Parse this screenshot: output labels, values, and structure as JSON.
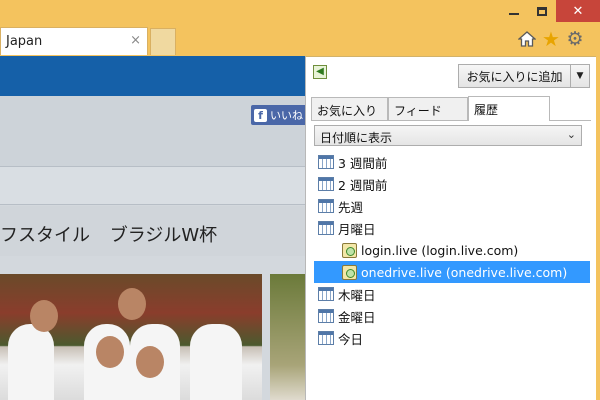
{
  "window": {
    "min_glyph": "",
    "close_glyph": "✕"
  },
  "tab": {
    "title": "Japan",
    "close_glyph": "×"
  },
  "toolbar_icons": [
    "home-icon",
    "star-icon",
    "gear-icon"
  ],
  "webpage": {
    "like_label": "いいね",
    "nav_text": "フスタイル ブラジルW杯"
  },
  "pane": {
    "add_favorites_label": "お気に入りに追加",
    "add_dropdown_glyph": "▼",
    "tabs": [
      {
        "label": "お気に入り",
        "active": false
      },
      {
        "label": "フィード",
        "active": false
      },
      {
        "label": "履歴",
        "active": true
      }
    ],
    "view_select": {
      "value": "日付順に表示",
      "chevron": "⌄"
    },
    "history": [
      {
        "label": "3 週間前",
        "type": "period"
      },
      {
        "label": "2 週間前",
        "type": "period"
      },
      {
        "label": "先週",
        "type": "period"
      },
      {
        "label": "月曜日",
        "type": "period"
      },
      {
        "label": "login.live (login.live.com)",
        "type": "site"
      },
      {
        "label": "onedrive.live (onedrive.live.com)",
        "type": "site",
        "selected": true
      },
      {
        "label": "木曜日",
        "type": "period"
      },
      {
        "label": "金曜日",
        "type": "period"
      },
      {
        "label": "今日",
        "type": "period"
      }
    ]
  },
  "colors": {
    "frame": "#f4c35e",
    "close_button": "#c7453a",
    "selection": "#3399ff",
    "site_header": "#1560a8"
  }
}
